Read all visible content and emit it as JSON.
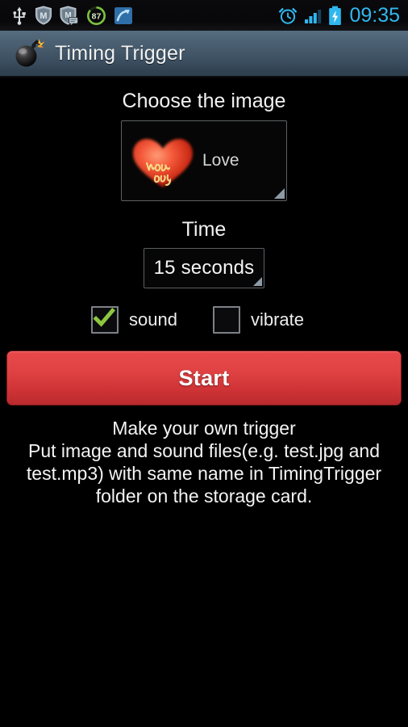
{
  "status_bar": {
    "icons_left": [
      {
        "name": "usb-icon",
        "label": "USB"
      },
      {
        "name": "shield-m-icon",
        "label": "M"
      },
      {
        "name": "shield-m-message-icon",
        "label": "M"
      },
      {
        "name": "battery-percent-circle-icon",
        "label": "87"
      },
      {
        "name": "sync-arrow-icon",
        "label": "sync"
      }
    ],
    "icons_right": [
      {
        "name": "alarm-clock-icon",
        "label": "alarm"
      },
      {
        "name": "signal-bars-icon",
        "label": "signal"
      },
      {
        "name": "battery-charging-icon",
        "label": "battery"
      }
    ],
    "battery_percent": "87",
    "clock": "09:35",
    "clock_color": "#2fb7ef"
  },
  "action_bar": {
    "icon_name": "bomb-icon",
    "title": "Timing Trigger"
  },
  "main": {
    "image_section": {
      "heading": "Choose the image",
      "selected_name": "Love",
      "thumbnail_name": "heart-love-you-image",
      "thumbnail_caption": "love you"
    },
    "time_section": {
      "heading": "Time",
      "selected_value": "15 seconds"
    },
    "options": [
      {
        "name": "sound",
        "label": "sound",
        "checked": true
      },
      {
        "name": "vibrate",
        "label": "vibrate",
        "checked": false
      }
    ],
    "start_button": {
      "label": "Start",
      "color": "#e04243"
    },
    "footer": {
      "line1": "Make your own trigger",
      "line2": "Put image and sound files(e.g. test.jpg and",
      "line3": "test.mp3) with same name in TimingTrigger",
      "line4": "folder on the storage card."
    }
  }
}
